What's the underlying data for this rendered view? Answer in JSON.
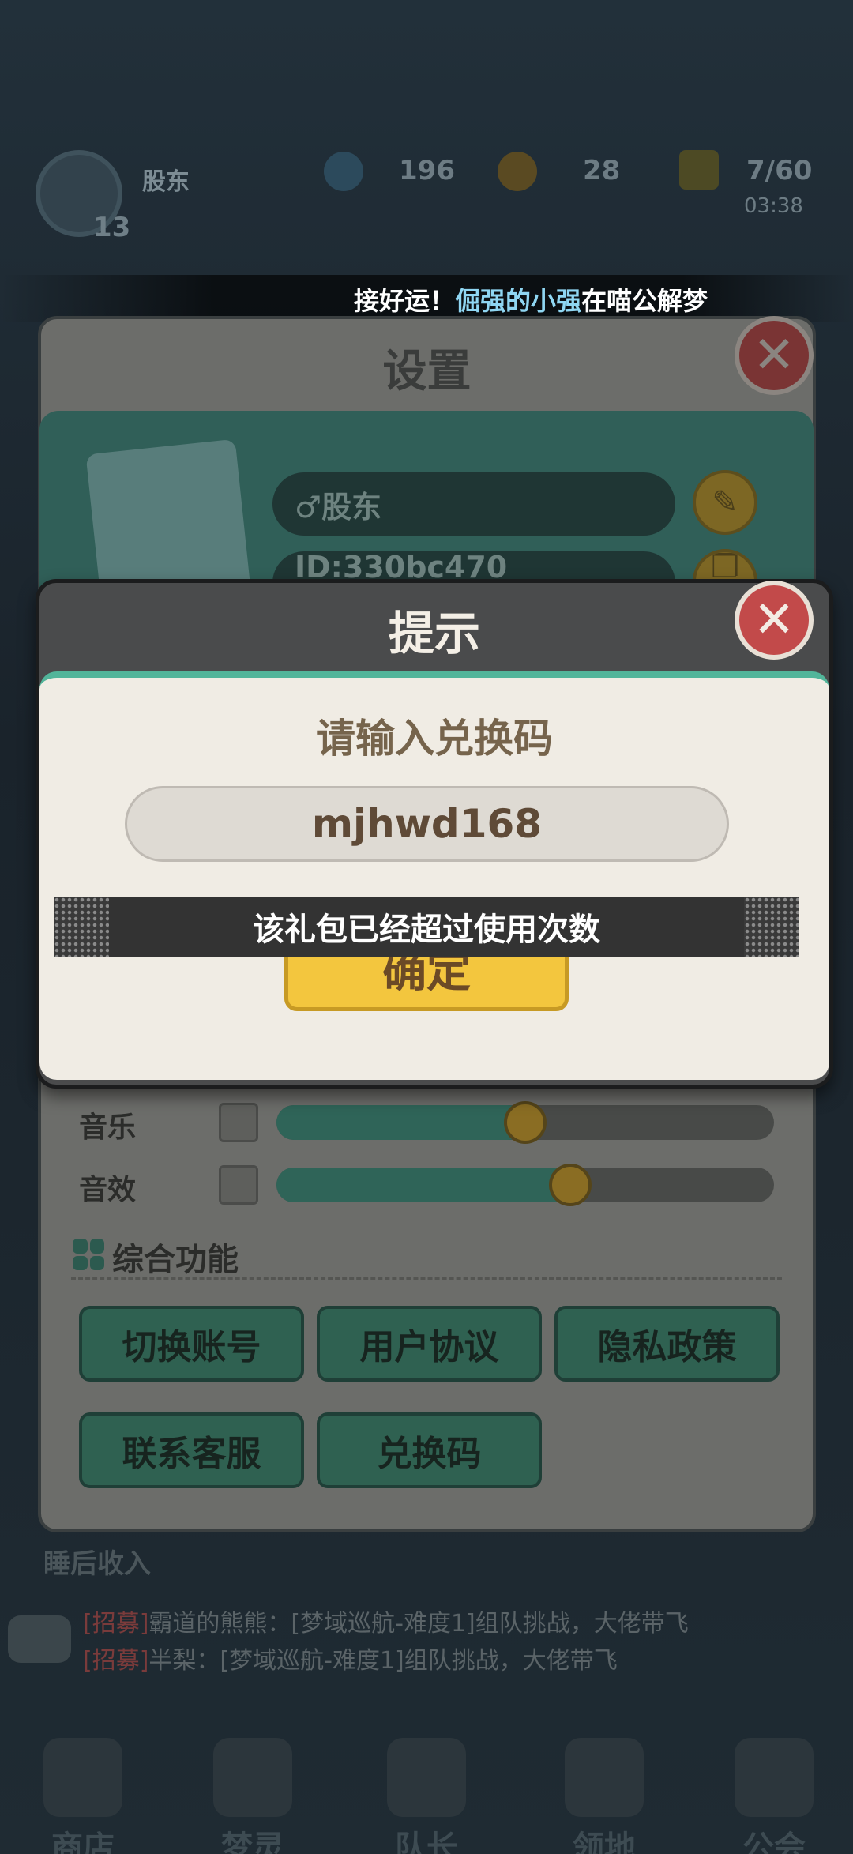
{
  "topbar": {
    "nickname": "股东",
    "level": "13",
    "gems": "196",
    "coins": "28",
    "energy": "7/60",
    "energy_timer": "03:38"
  },
  "ticker": {
    "prefix": "接好运！",
    "player": "倔强的小强",
    "suffix": "在喵公解梦"
  },
  "settings": {
    "title": "设置",
    "nickname": "♂股东",
    "id_text": "ID:330bc470",
    "music_label": "音乐",
    "music_level": 0.5,
    "sfx_label": "音效",
    "sfx_level": 0.59,
    "section_title": "综合功能",
    "buttons": [
      "切换账号",
      "用户协议",
      "隐私政策",
      "联系客服",
      "兑换码"
    ]
  },
  "background": {
    "income_label": "睡后收入",
    "chat": [
      {
        "tag": "[招募]",
        "text": "霸道的熊熊：[梦域巡航-难度1]组队挑战，大佬带飞"
      },
      {
        "tag": "[招募]",
        "text": "半梨：[梦域巡航-难度1]组队挑战，大佬带飞"
      }
    ],
    "nav": [
      "商店",
      "梦灵",
      "队长",
      "领地",
      "公会"
    ]
  },
  "dialog": {
    "title": "提示",
    "prompt": "请输入兑换码",
    "code_value": "mjhwd168",
    "confirm_label": "确定",
    "toast": "该礼包已经超过使用次数"
  },
  "colors": {
    "dialog_accent": "#52b59a",
    "confirm_yellow": "#f3c63e",
    "close_red": "#c24a4a"
  }
}
